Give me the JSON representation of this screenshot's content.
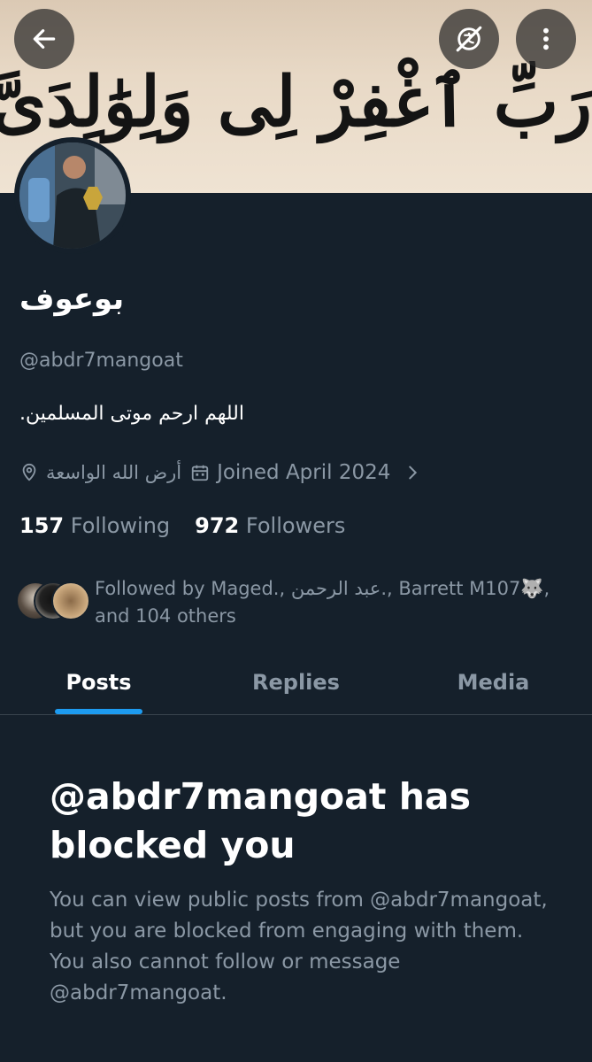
{
  "banner": {
    "calligraphy": "رَبِّ ٱغْفِرْ لِى وَلِوَٰلِدَىَّ"
  },
  "header": {
    "back_icon": "arrow-left-icon",
    "translate_icon": "no-translate-icon",
    "more_icon": "more-vertical-icon"
  },
  "profile": {
    "display_name": "بوعوف",
    "handle": "@abdr7mangoat",
    "bio": "اللهم ارحم موتى المسلمين.",
    "location": "أرض الله الواسعة",
    "joined": "Joined April 2024",
    "following_count": "157",
    "following_label": "Following",
    "followers_count": "972",
    "followers_label": "Followers",
    "followed_by": "Followed by Maged., عبد الرحمن., Barrett M107🐺, and 104 others"
  },
  "tabs": [
    {
      "label": "Posts",
      "active": true
    },
    {
      "label": "Replies",
      "active": false
    },
    {
      "label": "Media",
      "active": false
    }
  ],
  "blocked": {
    "title": "@abdr7mangoat has blocked you",
    "description": "You can view public posts from @abdr7mangoat, but you are blocked from engaging with them. You also cannot follow or message @abdr7mangoat."
  },
  "colors": {
    "background": "#15202b",
    "accent": "#1d9bf0",
    "secondary_text": "#8b98a5",
    "banner": "#e8d9c6"
  }
}
